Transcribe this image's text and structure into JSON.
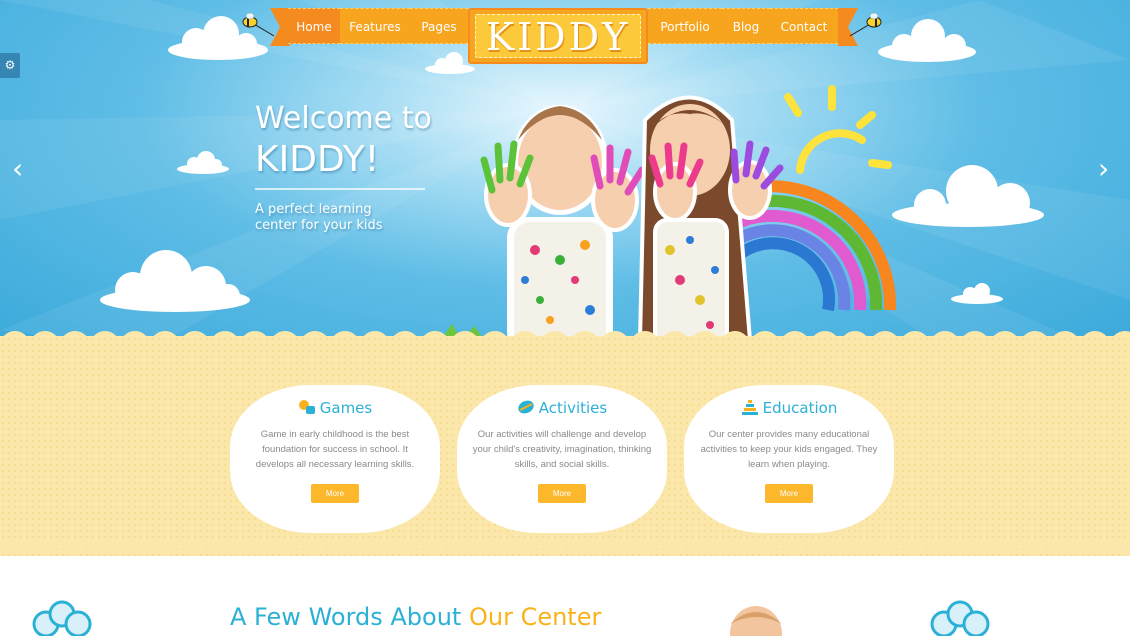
{
  "nav": {
    "left": [
      {
        "label": "Home"
      },
      {
        "label": "Features"
      },
      {
        "label": "Pages"
      }
    ],
    "right": [
      {
        "label": "Portfolio"
      },
      {
        "label": "Blog"
      },
      {
        "label": "Contact"
      }
    ],
    "logo": "KIDDY"
  },
  "hero": {
    "title_line1": "Welcome to",
    "title_line2": "KIDDY!",
    "subtitle": "A perfect learning center for your kids",
    "prev_arrow": "‹",
    "next_arrow": "›"
  },
  "features": [
    {
      "title": "Games",
      "icon": "games-icon",
      "text": "Game in early childhood is the best foundation for success in school. It develops all necessary learning skills.",
      "button": "More"
    },
    {
      "title": "Activities",
      "icon": "activities-icon",
      "text": "Our activities will challenge and develop your child's creativity, imagination, thinking skills, and social skills.",
      "button": "More"
    },
    {
      "title": "Education",
      "icon": "education-icon",
      "text": "Our center provides many educational activities to keep your kids engaged. They learn when playing.",
      "button": "More"
    }
  ],
  "about": {
    "title_main": "A Few Words About ",
    "title_accent": "Our Center"
  },
  "colors": {
    "sky": "#3aa9da",
    "nav_orange": "#f7a51e",
    "accent_blue": "#2bb0d6",
    "accent_yellow": "#f9b21c",
    "band_yellow": "#fbe7aa"
  }
}
